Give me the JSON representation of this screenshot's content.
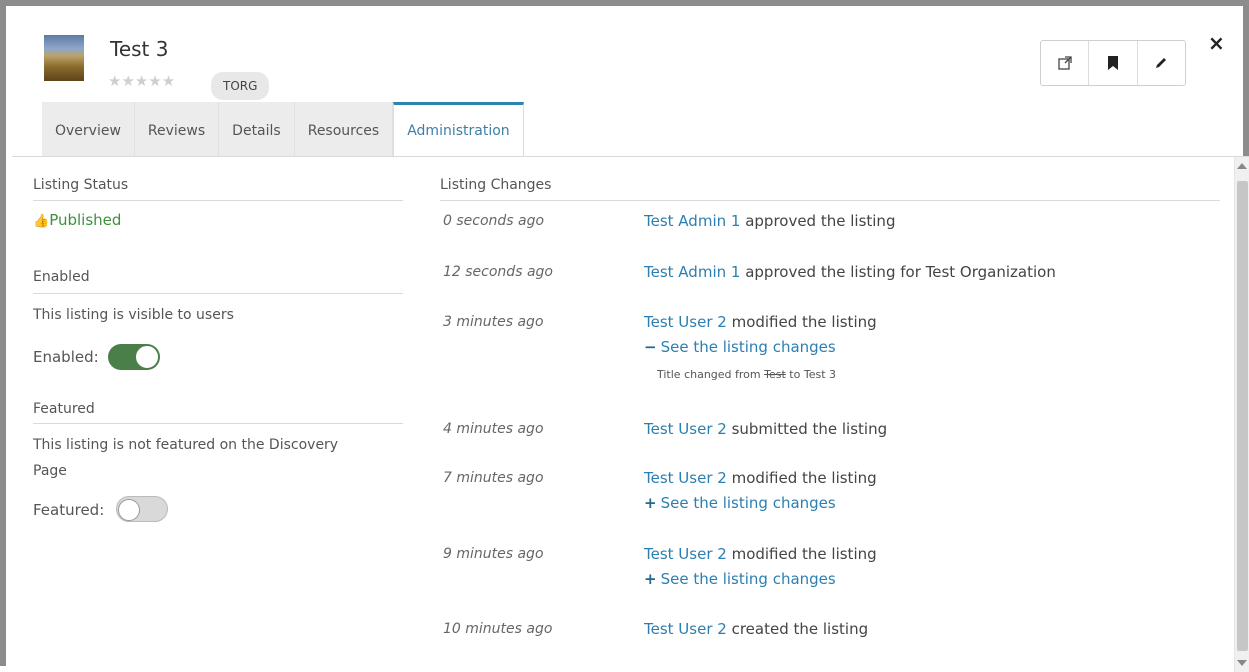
{
  "listing": {
    "title": "Test 3",
    "rating_stars": "★★★★★",
    "tag": "TORG"
  },
  "tabs": [
    "Overview",
    "Reviews",
    "Details",
    "Resources",
    "Administration"
  ],
  "actions": {
    "icons": [
      "external-link-icon",
      "bookmark-icon",
      "pencil-icon"
    ],
    "close": "×"
  },
  "left": {
    "listing_status_label": "Listing Status",
    "published_icon": "👍",
    "published_label": "Published",
    "enabled_label": "Enabled",
    "enabled_desc": "This listing is visible to users",
    "enabled_toggle_label": "Enabled:",
    "enabled_value": true,
    "featured_label": "Featured",
    "featured_desc_1": "This listing is not featured on the Discovery",
    "featured_desc_2": "Page",
    "featured_toggle_label": "Featured:",
    "featured_value": false
  },
  "changes": {
    "header": "Listing Changes",
    "items": [
      {
        "time": "0 seconds ago",
        "user": "Test Admin 1",
        "action": " approved the listing"
      },
      {
        "time": "12 seconds ago",
        "user": "Test Admin 1",
        "action": " approved the listing for Test Organization"
      },
      {
        "time": "3 minutes ago",
        "user": "Test User 2",
        "action": " modified the listing",
        "link_sign": "−",
        "link": "See the listing changes",
        "detail_prefix": "Title changed from ",
        "detail_old": "Test",
        "detail_mid": " to ",
        "detail_new": "Test 3"
      },
      {
        "time": "4 minutes ago",
        "user": "Test User 2",
        "action": " submitted the listing"
      },
      {
        "time": "7 minutes ago",
        "user": "Test User 2",
        "action": " modified the listing",
        "link_sign": "+",
        "link": "See the listing changes"
      },
      {
        "time": "9 minutes ago",
        "user": "Test User 2",
        "action": " modified the listing",
        "link_sign": "+",
        "link": "See the listing changes"
      },
      {
        "time": "10 minutes ago",
        "user": "Test User 2",
        "action": " created the listing"
      }
    ]
  },
  "colors": {
    "accent": "#2c7fb0",
    "published_green": "#3f8f3f",
    "toggle_on": "#4a7f4a"
  }
}
